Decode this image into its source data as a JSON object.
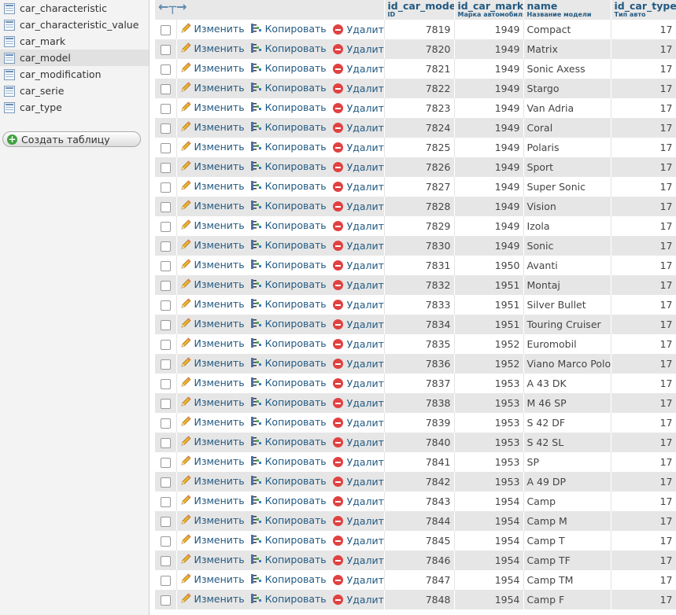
{
  "sidebar": {
    "tables": [
      "car_characteristic",
      "car_characteristic_value",
      "car_mark",
      "car_model",
      "car_modification",
      "car_serie",
      "car_type"
    ],
    "active": "car_model",
    "create_button": "Создать таблицу"
  },
  "grid": {
    "columns": [
      {
        "name": "id_car_model",
        "comment": "ID"
      },
      {
        "name": "id_car_mark",
        "comment": "Марка автомобиля"
      },
      {
        "name": "name",
        "comment": "Название модели"
      },
      {
        "name": "id_car_type",
        "comment": "Тип авто"
      }
    ],
    "actions": {
      "edit": "Изменить",
      "copy": "Копировать",
      "delete": "Удалить"
    },
    "rows": [
      [
        "7819",
        "1949",
        "Compact",
        "17"
      ],
      [
        "7820",
        "1949",
        "Matrix",
        "17"
      ],
      [
        "7821",
        "1949",
        "Sonic Axess",
        "17"
      ],
      [
        "7822",
        "1949",
        "Stargo",
        "17"
      ],
      [
        "7823",
        "1949",
        "Van Adria",
        "17"
      ],
      [
        "7824",
        "1949",
        "Coral",
        "17"
      ],
      [
        "7825",
        "1949",
        "Polaris",
        "17"
      ],
      [
        "7826",
        "1949",
        "Sport",
        "17"
      ],
      [
        "7827",
        "1949",
        "Super Sonic",
        "17"
      ],
      [
        "7828",
        "1949",
        "Vision",
        "17"
      ],
      [
        "7829",
        "1949",
        "Izola",
        "17"
      ],
      [
        "7830",
        "1949",
        "Sonic",
        "17"
      ],
      [
        "7831",
        "1950",
        "Avanti",
        "17"
      ],
      [
        "7832",
        "1951",
        "Montaj",
        "17"
      ],
      [
        "7833",
        "1951",
        "Silver Bullet",
        "17"
      ],
      [
        "7834",
        "1951",
        "Touring Cruiser",
        "17"
      ],
      [
        "7835",
        "1952",
        "Euromobil",
        "17"
      ],
      [
        "7836",
        "1952",
        "Viano Marco Polo",
        "17"
      ],
      [
        "7837",
        "1953",
        "A 43 DK",
        "17"
      ],
      [
        "7838",
        "1953",
        "M 46 SP",
        "17"
      ],
      [
        "7839",
        "1953",
        "S 42 DF",
        "17"
      ],
      [
        "7840",
        "1953",
        "S 42 SL",
        "17"
      ],
      [
        "7841",
        "1953",
        "SP",
        "17"
      ],
      [
        "7842",
        "1953",
        "A 49 DP",
        "17"
      ],
      [
        "7843",
        "1954",
        "Camp",
        "17"
      ],
      [
        "7844",
        "1954",
        "Camp M",
        "17"
      ],
      [
        "7845",
        "1954",
        "Camp T",
        "17"
      ],
      [
        "7846",
        "1954",
        "Camp TF",
        "17"
      ],
      [
        "7847",
        "1954",
        "Camp TM",
        "17"
      ],
      [
        "7848",
        "1954",
        "Camp F",
        "17"
      ]
    ]
  }
}
